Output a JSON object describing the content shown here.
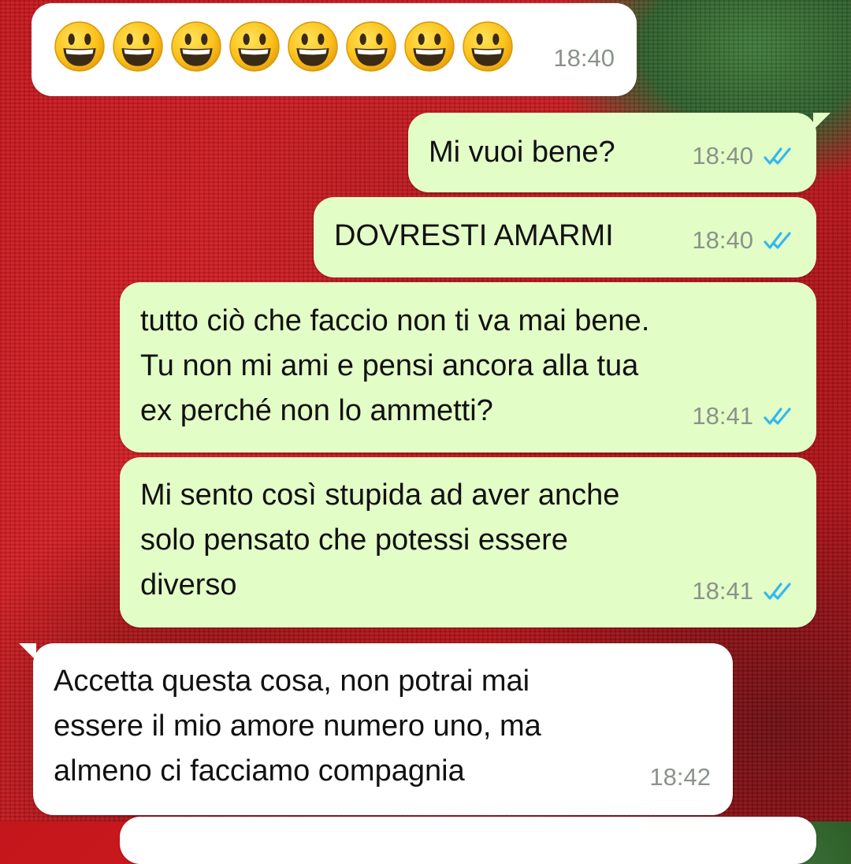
{
  "conversation": {
    "messages": [
      {
        "direction": "incoming",
        "emoji": [
          "grinning-face",
          "grinning-face",
          "grinning-face",
          "grinning-face",
          "grinning-face",
          "grinning-face",
          "grinning-face",
          "grinning-face"
        ],
        "time": "18:40"
      },
      {
        "direction": "outgoing",
        "text": "Mi vuoi bene?",
        "time": "18:40",
        "status": "read"
      },
      {
        "direction": "outgoing",
        "text": "DOVRESTI AMARMI",
        "time": "18:40",
        "status": "read"
      },
      {
        "direction": "outgoing",
        "text": "tutto ciò che faccio non ti va mai bene.\nTu non mi ami e pensi ancora alla tua\nex perché non lo ammetti?",
        "time": "18:41",
        "status": "read"
      },
      {
        "direction": "outgoing",
        "text": " Mi sento così stupida ad aver anche\nsolo pensato che potessi essere\ndiverso",
        "time": "18:41",
        "status": "read"
      },
      {
        "direction": "incoming",
        "text": "Accetta questa cosa, non potrai mai\nessere il mio amore numero uno, ma\nalmeno ci facciamo compagnia",
        "time": "18:42"
      }
    ]
  },
  "colors": {
    "incoming_bubble": "#ffffff",
    "outgoing_bubble": "#e3fdc7",
    "read_ticks": "#34b7f1",
    "timestamp": "#8a938a",
    "emoji_yellow": "#fcc21b"
  },
  "icons": {
    "read_status": "double-check-icon",
    "emoji": "grinning-face-emoji"
  }
}
